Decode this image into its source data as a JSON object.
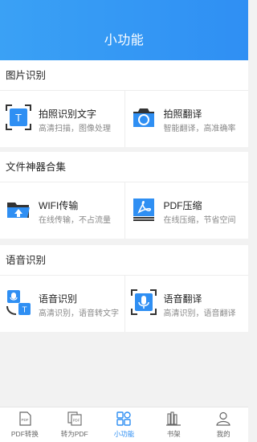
{
  "header": {
    "title": "小功能"
  },
  "sections": [
    {
      "title": "图片识别",
      "items": [
        {
          "name": "拍照识别文字",
          "desc": "高清扫描，图像处理",
          "icon": "photo-text-icon"
        },
        {
          "name": "拍照翻译",
          "desc": "智能翻译，高准确率",
          "icon": "camera-icon"
        }
      ]
    },
    {
      "title": "文件神器合集",
      "items": [
        {
          "name": "WIFI传输",
          "desc": "在线传输，不占流量",
          "icon": "folder-upload-icon"
        },
        {
          "name": "PDF压缩",
          "desc": "在线压缩，节省空间",
          "icon": "pdf-icon"
        }
      ]
    },
    {
      "title": "语音识别",
      "items": [
        {
          "name": "语音识别",
          "desc": "高清识别，语音转文字",
          "icon": "voice-to-text-icon"
        },
        {
          "name": "语音翻译",
          "desc": "高清识别，语音翻译",
          "icon": "microphone-icon"
        }
      ]
    }
  ],
  "tabbar": {
    "active": 2,
    "tabs": [
      {
        "label": "PDF转换",
        "icon": "pdf-document-icon"
      },
      {
        "label": "转为PDF",
        "icon": "pdf-convert-icon"
      },
      {
        "label": "小功能",
        "icon": "grid-icon"
      },
      {
        "label": "书架",
        "icon": "bookshelf-icon"
      },
      {
        "label": "我的",
        "icon": "person-icon"
      }
    ]
  },
  "colors": {
    "accent": "#2f8ff3",
    "header_start": "#3aa1f5",
    "text": "#222222",
    "muted": "#888888"
  }
}
